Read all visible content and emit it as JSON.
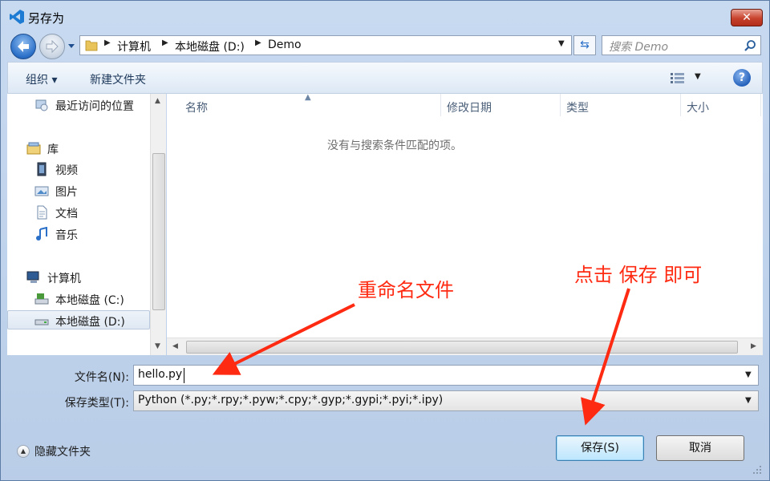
{
  "window": {
    "title": "另存为",
    "close_label": "✕"
  },
  "address_bar": {
    "crumbs": [
      "计算机",
      "本地磁盘 (D:)",
      "Demo"
    ],
    "search_placeholder": "搜索 Demo"
  },
  "toolbar": {
    "organize_label": "组织 ▾",
    "new_folder_label": "新建文件夹",
    "help_label": "?"
  },
  "nav_pane": {
    "items": [
      {
        "label": "最近访问的位置",
        "icon": "recent-places-icon"
      },
      {
        "label": "库",
        "icon": "library-icon"
      },
      {
        "label": "视频",
        "icon": "video-icon"
      },
      {
        "label": "图片",
        "icon": "pictures-icon"
      },
      {
        "label": "文档",
        "icon": "documents-icon"
      },
      {
        "label": "音乐",
        "icon": "music-icon"
      },
      {
        "label": "计算机",
        "icon": "computer-icon"
      },
      {
        "label": "本地磁盘 (C:)",
        "icon": "drive-icon"
      },
      {
        "label": "本地磁盘 (D:)",
        "icon": "drive-icon",
        "selected": true
      }
    ]
  },
  "file_list": {
    "columns": [
      "名称",
      "修改日期",
      "类型",
      "大小"
    ],
    "empty_message": "没有与搜索条件匹配的项。"
  },
  "form": {
    "filename_label": "文件名(N):",
    "filename_value": "hello.py",
    "filetype_label": "保存类型(T):",
    "filetype_value": "Python (*.py;*.rpy;*.pyw;*.cpy;*.gyp;*.gypi;*.pyi;*.ipy)",
    "hide_folders_label": "隐藏文件夹",
    "save_label": "保存(S)",
    "cancel_label": "取消"
  },
  "annotations": {
    "rename_note": "重命名文件",
    "save_note": "点击 保存 即可",
    "color": "#ff2a12"
  }
}
